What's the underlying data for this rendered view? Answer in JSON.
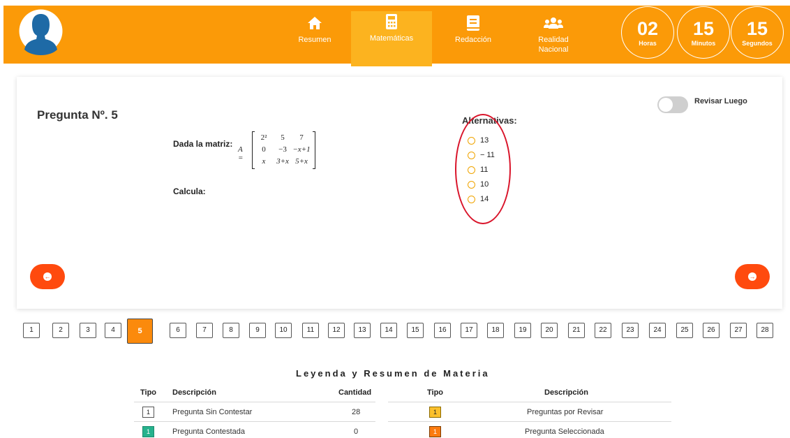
{
  "header": {
    "nav": [
      {
        "label": "Resumen",
        "icon": "home-icon"
      },
      {
        "label": "Matemáticas",
        "icon": "calculator-icon"
      },
      {
        "label": "Redacción",
        "icon": "book-icon"
      },
      {
        "label": "Realidad\nNacional",
        "label_line1": "Realidad",
        "label_line2": "Nacional",
        "icon": "users-icon"
      }
    ],
    "timer": {
      "hours": "02",
      "hours_label": "Horas",
      "minutes": "15",
      "minutes_label": "Minutos",
      "seconds": "15",
      "seconds_label": "Segundos"
    },
    "colors": {
      "bar": "#fb9a08",
      "active_tab": "#fcb31f"
    }
  },
  "question": {
    "title": "Pregunta Nº. 5",
    "statement": "Dada la matriz:",
    "matrix_name": "A =",
    "matrix": [
      [
        "2²",
        "5",
        "7"
      ],
      [
        "0",
        "−3",
        "−x+1"
      ],
      [
        "x",
        "3+x",
        "5+x"
      ]
    ],
    "prompt": "Calcula:",
    "review_label": "Revisar Luego",
    "alternatives_title": "Alternativas:",
    "alternatives": [
      "13",
      "− 11",
      "11",
      "10",
      "14"
    ]
  },
  "pagination": {
    "pages": [
      "1",
      "2",
      "3",
      "4",
      "5",
      "6",
      "7",
      "8",
      "9",
      "10",
      "11",
      "12",
      "13",
      "14",
      "15",
      "16",
      "17",
      "18",
      "19",
      "20",
      "21",
      "22",
      "23",
      "24",
      "25",
      "26",
      "27",
      "28"
    ],
    "current": "5"
  },
  "legend": {
    "title": "Leyenda y Resumen de Materia",
    "left_headers": {
      "tipo": "Tipo",
      "descripcion": "Descripción",
      "cantidad": "Cantidad"
    },
    "right_headers": {
      "tipo": "Tipo",
      "descripcion": "Descripción"
    },
    "left_rows": [
      {
        "box": "1",
        "description": "Pregunta Sin Contestar",
        "count": "28"
      },
      {
        "box": "1",
        "description": "Pregunta Contestada",
        "count": "0"
      }
    ],
    "right_rows": [
      {
        "box": "1",
        "description": "Preguntas por Revisar"
      },
      {
        "box": "1",
        "description": "Pregunta Seleccionada"
      }
    ]
  }
}
